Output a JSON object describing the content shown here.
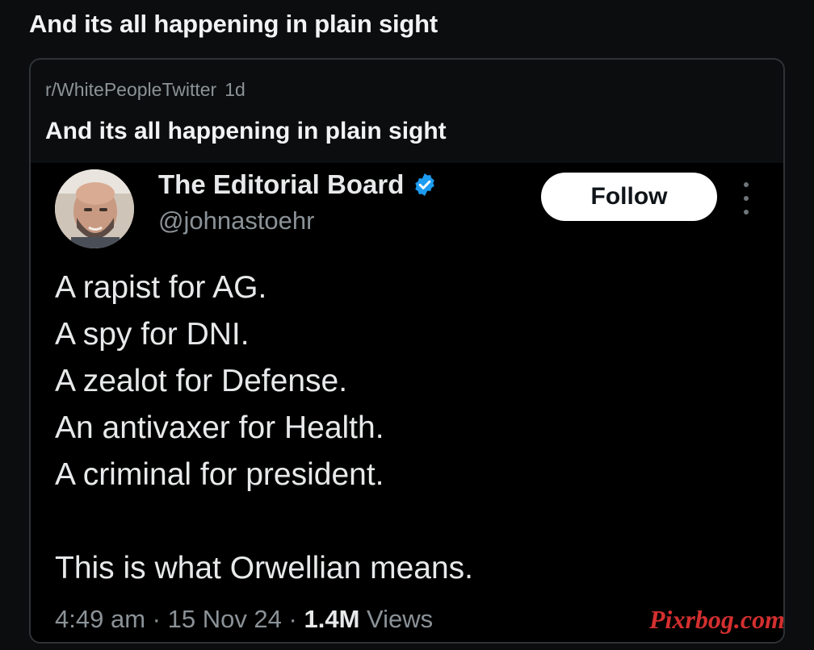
{
  "post": {
    "title": "And its all happening in plain sight"
  },
  "crosspost": {
    "subreddit": "r/WhitePeopleTwitter",
    "age": "1d",
    "title": "And its all happening in plain sight"
  },
  "tweet": {
    "author_name": "The Editorial Board",
    "handle": "@johnastoehr",
    "follow_label": "Follow",
    "verified_icon": "verified-badge-icon",
    "verified_color": "#1d9bf0",
    "lines": [
      "A rapist for AG.",
      "A spy for DNI.",
      "A zealot for Defense.",
      "An antivaxer for Health.",
      "A criminal for president.",
      "",
      "This is what Orwellian means."
    ],
    "time": "4:49 am",
    "date": "15 Nov 24",
    "views_count": "1.4M",
    "views_label": "Views",
    "separator": "·"
  },
  "watermark": "Pixrbog.com",
  "colors": {
    "background": "#0b0d0e",
    "tweet_background": "#000000",
    "follow_bg": "#ffffff",
    "watermark": "#d32f2f"
  }
}
